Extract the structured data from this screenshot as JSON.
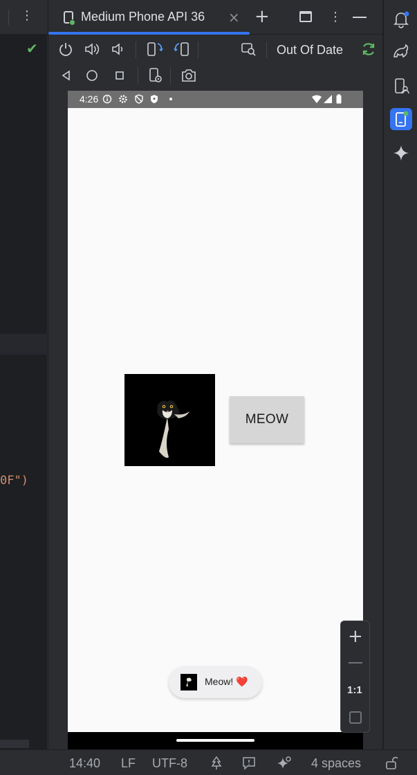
{
  "device_tab": {
    "name": "Medium Phone API 36"
  },
  "toolbar": {
    "out_of_date_label": "Out Of Date"
  },
  "phone": {
    "status_time": "4:26",
    "button_label": "MEOW",
    "toast_text": "Meow! ❤️"
  },
  "zoom": {
    "ratio_label": "1:1"
  },
  "editor": {
    "code_fragment": "0F\")"
  },
  "status_bar": {
    "position": "14:40",
    "line_ending": "LF",
    "encoding": "UTF-8",
    "indent": "4 spaces"
  },
  "colors": {
    "accent": "#3574f0",
    "success": "#5fb865",
    "heart": "#e53935"
  },
  "icons": [
    "power-icon",
    "volume-up-icon",
    "volume-down-icon",
    "rotate-left-icon",
    "rotate-right-icon",
    "snapshot-search-icon",
    "back-icon",
    "home-icon",
    "overview-icon",
    "device-settings-icon",
    "camera-icon",
    "refresh-icon",
    "notifications-icon",
    "gradle-icon",
    "device-manager-icon",
    "running-devices-icon",
    "gemini-icon"
  ]
}
